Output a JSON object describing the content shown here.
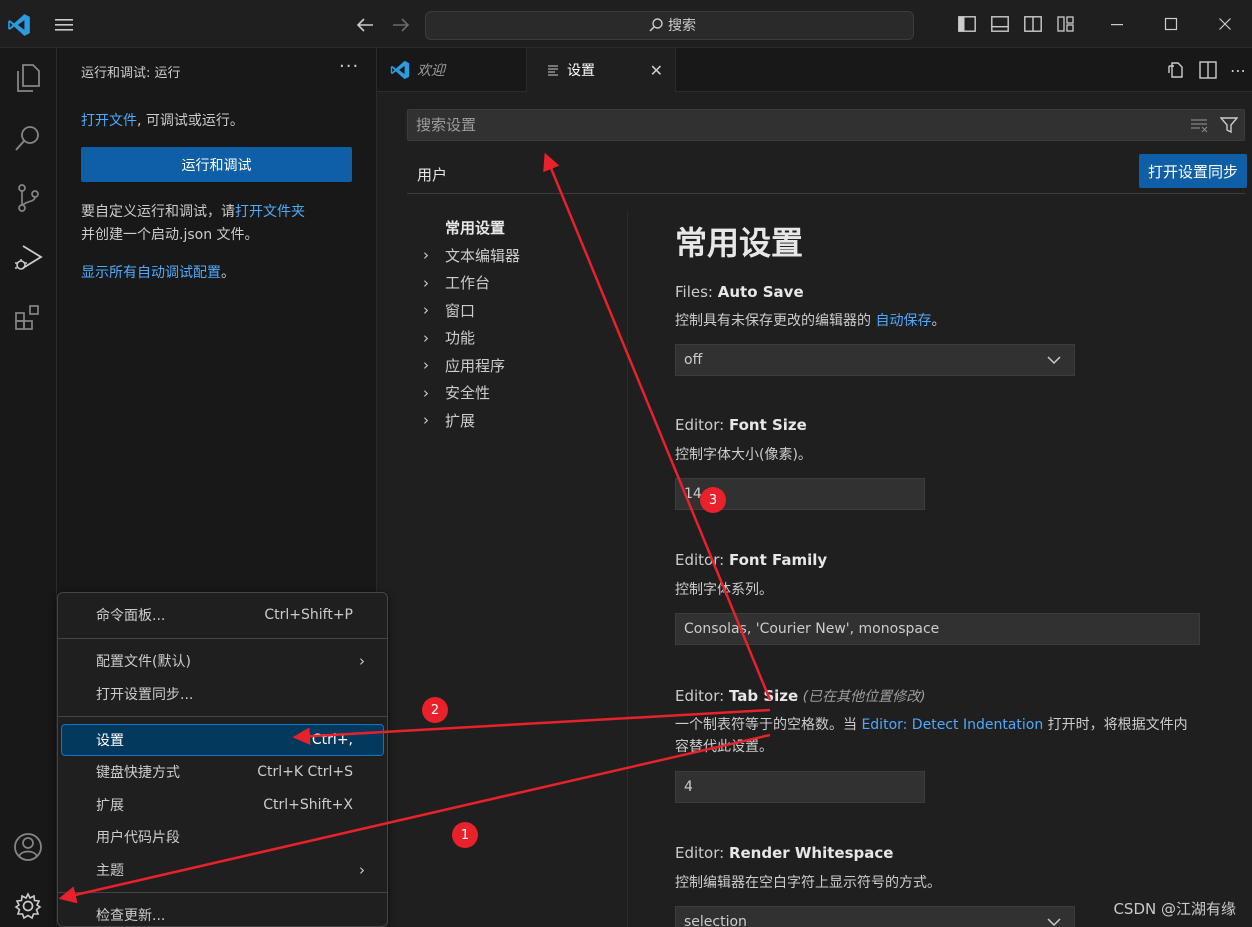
{
  "titlebar": {
    "search_label": "搜索",
    "back_icon": "arrow-left-icon",
    "forward_icon": "arrow-right-icon"
  },
  "sidebar": {
    "title": "运行和调试: 运行",
    "more": "···",
    "line1_link": "打开文件",
    "line1_text": ", 可调试或运行。",
    "run_button": "运行和调试",
    "line2_text": "要自定义运行和调试，请",
    "line2_link": "打开文件夹",
    "line3_text": "并创建一个启动.json 文件。",
    "line4_link": "显示所有自动调试配置",
    "line4_text": "。"
  },
  "tabs": {
    "welcome": "欢迎",
    "settings": "设置"
  },
  "settings": {
    "search_placeholder": "搜索设置",
    "scope_tab": "用户",
    "sync_button": "打开设置同步",
    "toc": {
      "active": "常用设置",
      "items": [
        "文本编辑器",
        "工作台",
        "窗口",
        "功能",
        "应用程序",
        "安全性",
        "扩展"
      ]
    },
    "section_title": "常用设置",
    "auto_save": {
      "category": "Files: ",
      "name": "Auto Save",
      "desc": "控制具有未保存更改的编辑器的 ",
      "desc_link": "自动保存",
      "desc_end": "。",
      "value": "off"
    },
    "font_size": {
      "category": "Editor: ",
      "name": "Font Size",
      "desc": "控制字体大小(像素)。",
      "value": "14"
    },
    "font_family": {
      "category": "Editor: ",
      "name": "Font Family",
      "desc": "控制字体系列。",
      "value": "Consolas, 'Courier New', monospace"
    },
    "tab_size": {
      "category": "Editor: ",
      "name": "Tab Size",
      "modified": " (已在其他位置修改)",
      "desc_a": "一个制表符等于的空格数。当 ",
      "desc_link": "Editor: Detect Indentation",
      "desc_b": " 打开时，将根据文件内",
      "desc_c": "容替代此设置。",
      "value": "4"
    },
    "render_whitespace": {
      "category": "Editor: ",
      "name": "Render Whitespace",
      "desc": "控制编辑器在空白字符上显示符号的方式。",
      "value": "selection"
    }
  },
  "menu": {
    "command_palette": "命令面板...",
    "command_palette_kb": "Ctrl+Shift+P",
    "profile": "配置文件(默认)",
    "settings_sync": "打开设置同步...",
    "settings": "设置",
    "settings_kb": "Ctrl+,",
    "keyboard_shortcuts": "键盘快捷方式",
    "keyboard_shortcuts_kb": "Ctrl+K Ctrl+S",
    "extensions": "扩展",
    "extensions_kb": "Ctrl+Shift+X",
    "snippets": "用户代码片段",
    "themes": "主题",
    "check_updates": "检查更新..."
  },
  "annotations": {
    "badge1": "1",
    "badge2": "2",
    "badge3": "3",
    "arrow_color": "#e8212b"
  },
  "watermark": "CSDN @江湖有缘"
}
